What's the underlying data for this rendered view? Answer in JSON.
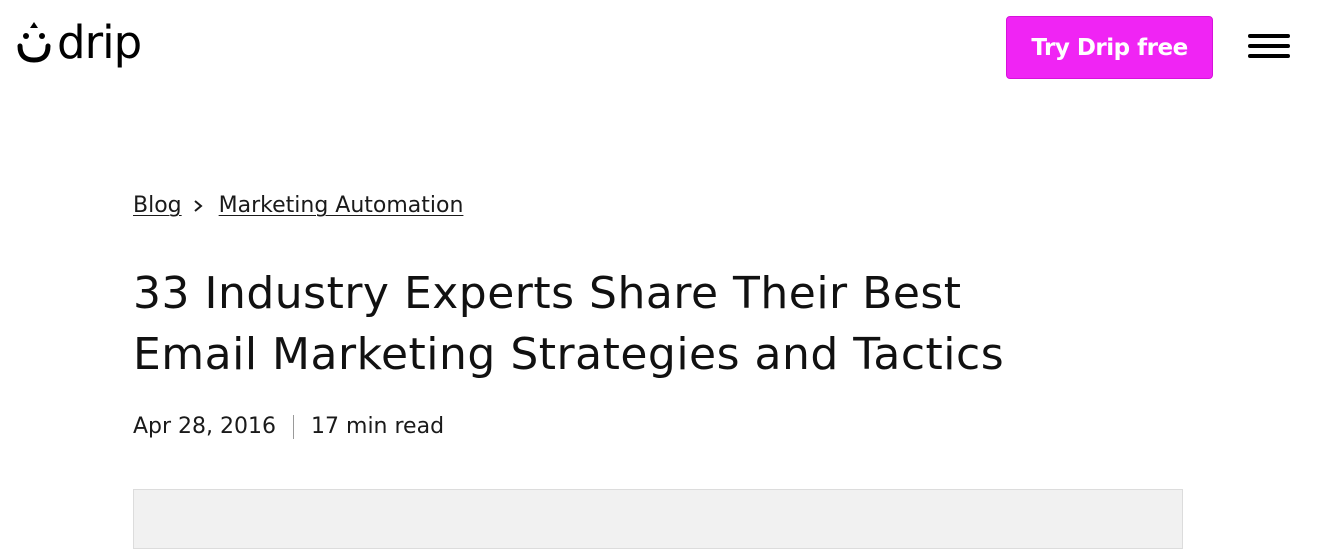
{
  "header": {
    "logo_text": "drip",
    "logo_icon": "drip-smile-icon",
    "cta_label": "Try Drip free",
    "menu_icon": "hamburger-menu-icon"
  },
  "colors": {
    "cta_background": "#f024f4",
    "text": "#1a1a1a",
    "image_placeholder": "#f1f1f1"
  },
  "breadcrumb": {
    "items": [
      {
        "label": "Blog"
      },
      {
        "label": "Marketing Automation"
      }
    ],
    "separator_icon": "chevron-right-icon"
  },
  "article": {
    "title_line_1": "33 Industry Experts Share Their Best",
    "title_line_2": "Email Marketing Strategies and Tactics",
    "date": "Apr 28, 2016",
    "read_time": "17 min read"
  }
}
